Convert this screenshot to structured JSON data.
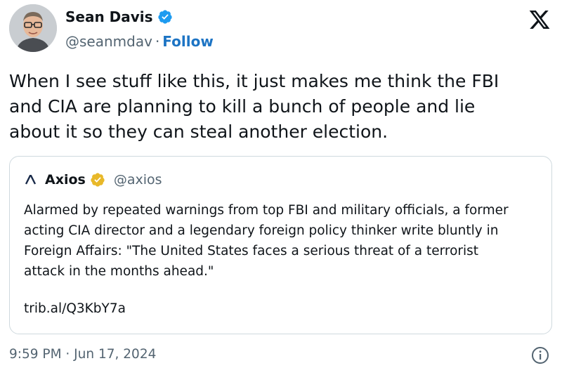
{
  "author": {
    "name": "Sean Davis",
    "handle": "@seanmdav",
    "separator": "·",
    "follow_label": "Follow",
    "verified_icon": "verified-badge-icon"
  },
  "brand_icon": "x-logo-icon",
  "tweet": {
    "lines": [
      "When I see stuff like this, it just makes me think the FBI",
      "and CIA are planning to kill a bunch of people and lie",
      "about it so they can steal another election."
    ]
  },
  "quoted": {
    "name": "Axios",
    "handle": "@axios",
    "badge_icon": "gold-verified-badge-icon",
    "lines": [
      "Alarmed by repeated warnings from top FBI and military officials, a former",
      "acting CIA director and a legendary foreign policy thinker write bluntly in",
      "Foreign Affairs: \"The United States faces a serious threat of a terrorist",
      "attack in the months ahead.\""
    ],
    "link": "trib.al/Q3KbY7a"
  },
  "timestamp": "9:59 PM · Jun 17, 2024",
  "colors": {
    "text": "#0f1419",
    "secondary": "#536471",
    "follow": "#1d74c4",
    "verified_blue": "#1d9bf0",
    "verified_gold": "#e8b829",
    "border": "#cfd9de"
  }
}
